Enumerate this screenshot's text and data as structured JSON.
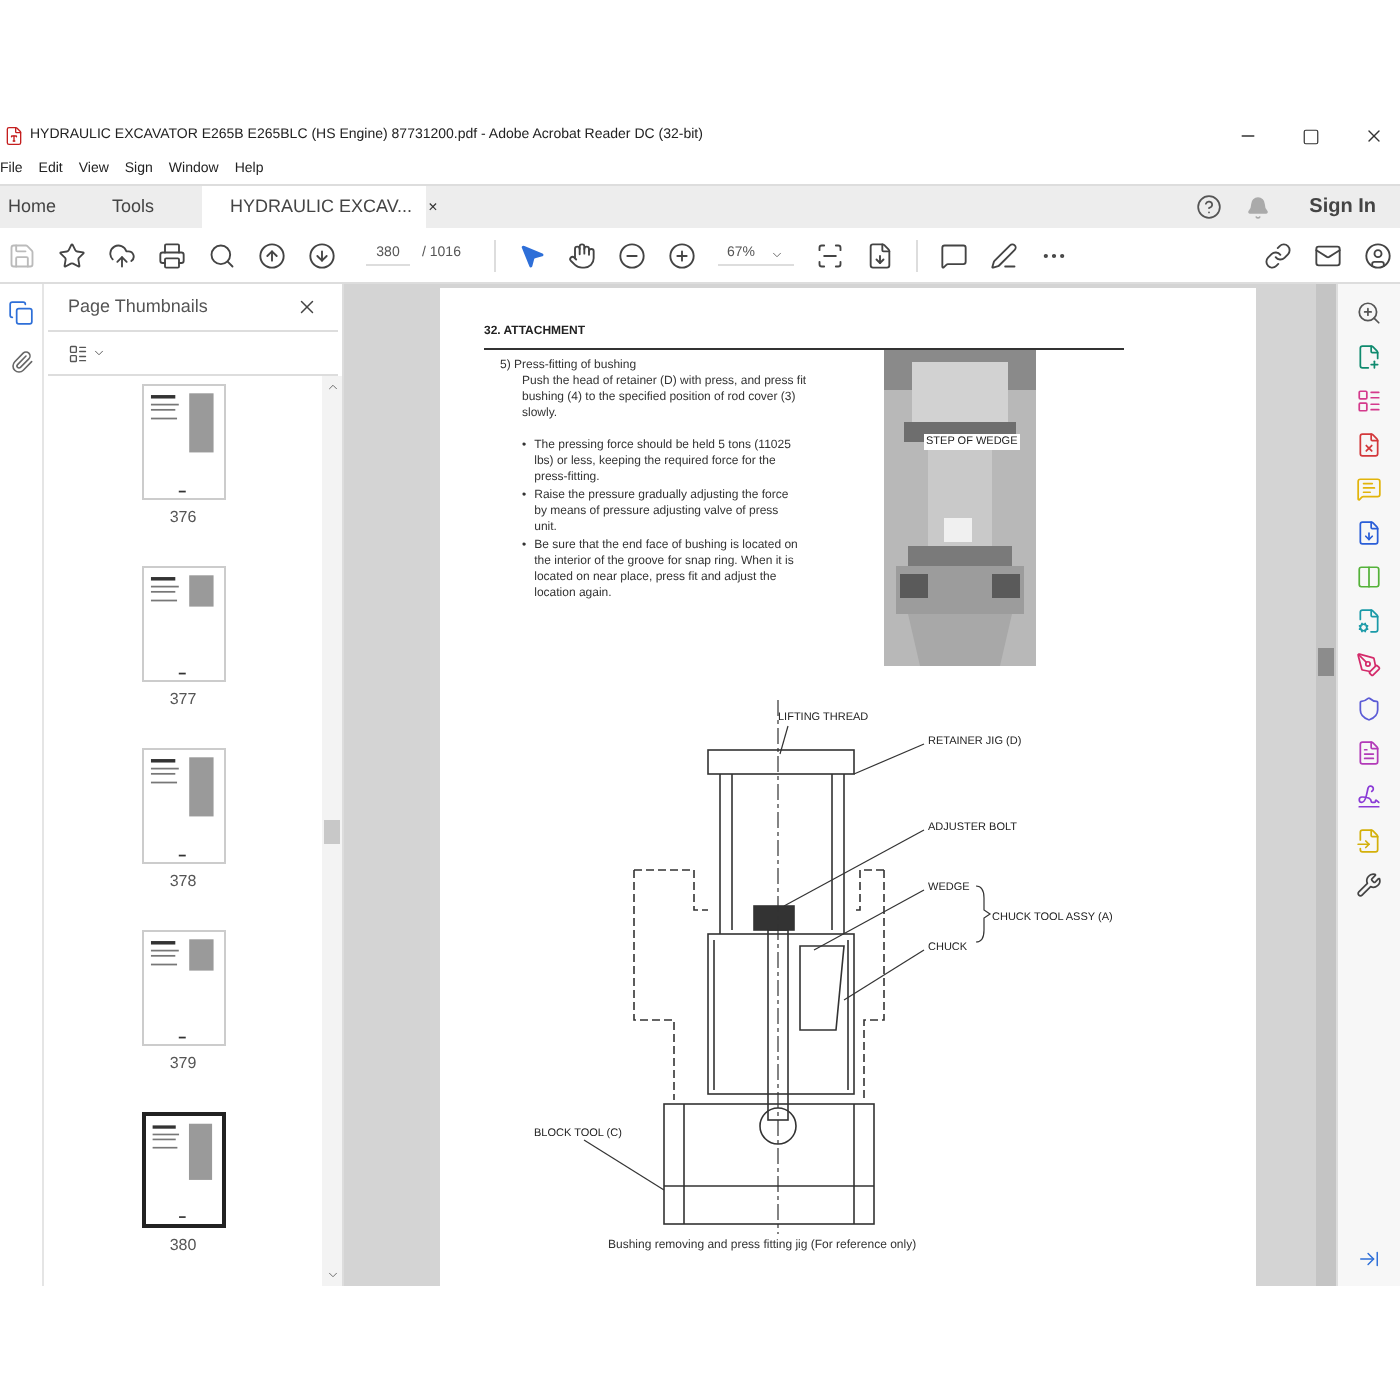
{
  "window": {
    "title": "HYDRAULIC EXCAVATOR E265B E265BLC (HS Engine) 87731200.pdf - Adobe Acrobat Reader DC (32-bit)"
  },
  "menu": [
    "File",
    "Edit",
    "View",
    "Sign",
    "Window",
    "Help"
  ],
  "tabs": [
    {
      "label": "Home",
      "selected": false
    },
    {
      "label": "Tools",
      "selected": false
    },
    {
      "label": "HYDRAULIC EXCAV...",
      "selected": true,
      "close": "×"
    }
  ],
  "sign_in": "Sign In",
  "toolbar": {
    "page_number": "380",
    "page_total": "/ 1016",
    "zoom": "67%"
  },
  "thumbnails": {
    "title": "Page Thumbnails",
    "pages": [
      {
        "label": "376",
        "selected": false
      },
      {
        "label": "377",
        "selected": false
      },
      {
        "label": "378",
        "selected": false
      },
      {
        "label": "379",
        "selected": false
      },
      {
        "label": "380",
        "selected": true
      }
    ]
  },
  "document": {
    "heading": "32. ATTACHMENT",
    "step": "5) Press-fitting of bushing",
    "intro": "Push the head of retainer (D) with press, and press fit bushing (4) to the specified position of rod cover (3) slowly.",
    "bullets": [
      {
        "marker": "•",
        "text": "The pressing force should be held 5 tons (11025 lbs) or less, keeping the required force for the press-fitting."
      },
      {
        "marker": "•",
        "text": "Raise the pressure gradually adjusting the force by means of pressure adjusting valve of press unit."
      },
      {
        "marker": "•",
        "text": "Be sure that the end face of bushing is located on the interior of the groove for snap ring. When it is located on near place, press fit and adjust the location again."
      }
    ],
    "photo_label": "STEP OF WEDGE",
    "diagram_labels": [
      "LIFTING THREAD",
      "RETAINER JIG (D)",
      "ADJUSTER BOLT",
      "WEDGE",
      "CHUCK TOOL ASSY (A)",
      "CHUCK",
      "BLOCK TOOL (C)"
    ],
    "caption": "Bushing removing and press fitting jig (For reference only)"
  }
}
